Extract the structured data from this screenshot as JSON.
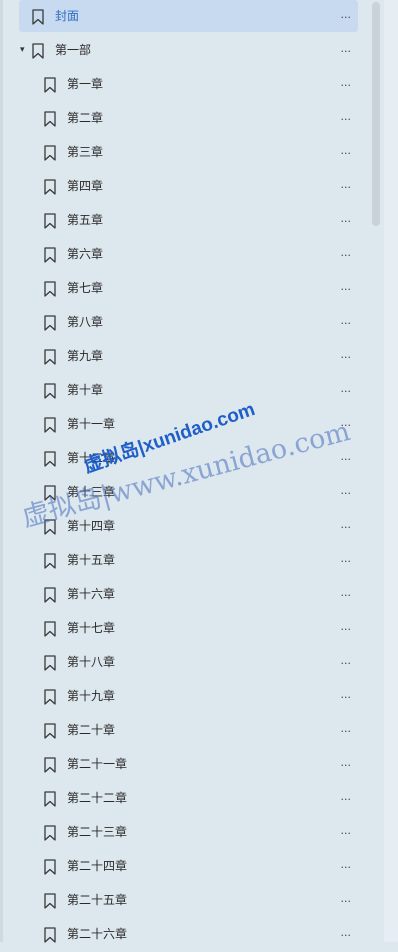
{
  "outline": {
    "items": [
      {
        "label": "封面",
        "level": 0,
        "selected": true,
        "toggle": "",
        "more": "..."
      },
      {
        "label": "第一部",
        "level": 0,
        "selected": false,
        "toggle": "▾",
        "more": "..."
      },
      {
        "label": "第一章",
        "level": 1,
        "selected": false,
        "toggle": "",
        "more": "..."
      },
      {
        "label": "第二章",
        "level": 1,
        "selected": false,
        "toggle": "",
        "more": "..."
      },
      {
        "label": "第三章",
        "level": 1,
        "selected": false,
        "toggle": "",
        "more": "..."
      },
      {
        "label": "第四章",
        "level": 1,
        "selected": false,
        "toggle": "",
        "more": "..."
      },
      {
        "label": "第五章",
        "level": 1,
        "selected": false,
        "toggle": "",
        "more": "..."
      },
      {
        "label": "第六章",
        "level": 1,
        "selected": false,
        "toggle": "",
        "more": "..."
      },
      {
        "label": "第七章",
        "level": 1,
        "selected": false,
        "toggle": "",
        "more": "..."
      },
      {
        "label": "第八章",
        "level": 1,
        "selected": false,
        "toggle": "",
        "more": "..."
      },
      {
        "label": "第九章",
        "level": 1,
        "selected": false,
        "toggle": "",
        "more": "..."
      },
      {
        "label": "第十章",
        "level": 1,
        "selected": false,
        "toggle": "",
        "more": "..."
      },
      {
        "label": "第十一章",
        "level": 1,
        "selected": false,
        "toggle": "",
        "more": "..."
      },
      {
        "label": "第十二章",
        "level": 1,
        "selected": false,
        "toggle": "",
        "more": "..."
      },
      {
        "label": "第十三章",
        "level": 1,
        "selected": false,
        "toggle": "",
        "more": "..."
      },
      {
        "label": "第十四章",
        "level": 1,
        "selected": false,
        "toggle": "",
        "more": "..."
      },
      {
        "label": "第十五章",
        "level": 1,
        "selected": false,
        "toggle": "",
        "more": "..."
      },
      {
        "label": "第十六章",
        "level": 1,
        "selected": false,
        "toggle": "",
        "more": "..."
      },
      {
        "label": "第十七章",
        "level": 1,
        "selected": false,
        "toggle": "",
        "more": "..."
      },
      {
        "label": "第十八章",
        "level": 1,
        "selected": false,
        "toggle": "",
        "more": "..."
      },
      {
        "label": "第十九章",
        "level": 1,
        "selected": false,
        "toggle": "",
        "more": "..."
      },
      {
        "label": "第二十章",
        "level": 1,
        "selected": false,
        "toggle": "",
        "more": "..."
      },
      {
        "label": "第二十一章",
        "level": 1,
        "selected": false,
        "toggle": "",
        "more": "..."
      },
      {
        "label": "第二十二章",
        "level": 1,
        "selected": false,
        "toggle": "",
        "more": "..."
      },
      {
        "label": "第二十三章",
        "level": 1,
        "selected": false,
        "toggle": "",
        "more": "..."
      },
      {
        "label": "第二十四章",
        "level": 1,
        "selected": false,
        "toggle": "",
        "more": "..."
      },
      {
        "label": "第二十五章",
        "level": 1,
        "selected": false,
        "toggle": "",
        "more": "..."
      },
      {
        "label": "第二十六章",
        "level": 1,
        "selected": false,
        "toggle": "",
        "more": "..."
      }
    ]
  },
  "watermark": {
    "primary": "虚拟岛|xunidao.com",
    "secondary": "虚拟岛|www.xunidao.com"
  },
  "colors": {
    "background": "#dde7ee",
    "selected_bg": "#c8daf0",
    "selected_text": "#2f6fc0",
    "watermark": "#1f5fc7"
  },
  "icons": {
    "bookmark": "bookmark-icon",
    "expand": "triangle-down-icon",
    "more": "ellipsis-icon"
  }
}
